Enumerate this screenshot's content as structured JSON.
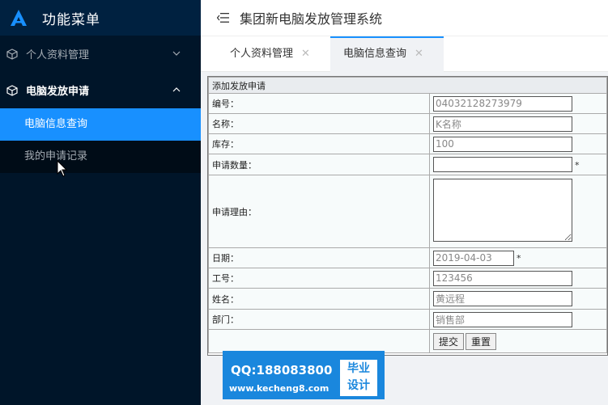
{
  "sidebar": {
    "brand_title": "功能菜单",
    "groups": [
      {
        "label": "个人资料管理"
      },
      {
        "label": "电脑发放申请"
      }
    ],
    "sub_items": [
      {
        "label": "电脑信息查询"
      },
      {
        "label": "我的申请记录"
      }
    ]
  },
  "header": {
    "title": "集团新电脑发放管理系统"
  },
  "tabs": [
    {
      "label": "个人资料管理"
    },
    {
      "label": "电脑信息查询"
    }
  ],
  "form": {
    "caption": "添加发放申请",
    "fields": {
      "number": {
        "label": "编号：",
        "value": "04032128273979"
      },
      "name": {
        "label": "名称：",
        "value": "K名称"
      },
      "stock": {
        "label": "库存：",
        "value": "100"
      },
      "quantity": {
        "label": "申请数量：",
        "value": "",
        "required": "*"
      },
      "reason": {
        "label": "申请理由：",
        "value": ""
      },
      "date": {
        "label": "日期：",
        "value": "2019-04-03",
        "required": "*"
      },
      "job_no": {
        "label": "工号：",
        "value": "123456"
      },
      "applicant": {
        "label": "姓名：",
        "value": "黄远程"
      },
      "department": {
        "label": "部门：",
        "value": "销售部"
      }
    },
    "submit_label": "提交",
    "reset_label": "重置"
  },
  "watermark": {
    "qq": "QQ:188083800",
    "url": "www.kecheng8.com",
    "badge_line1": "毕业",
    "badge_line2": "设计"
  },
  "colors": {
    "sidebar_bg": "#001529",
    "accent": "#1890ff",
    "watermark": "#1a87dd"
  }
}
